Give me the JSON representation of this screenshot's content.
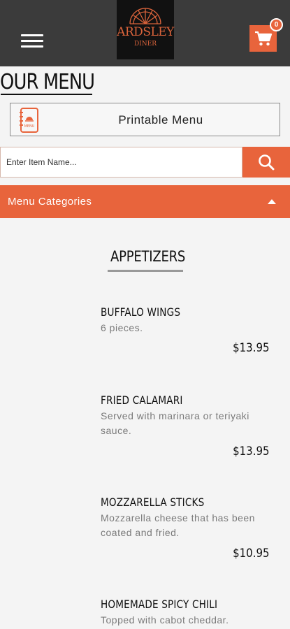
{
  "header": {
    "logo": {
      "name": "ARDSLEY",
      "sub": "DINER"
    },
    "cart_count": "0",
    "accent_color": "#e8643c",
    "bar_color": "#3b3b3b"
  },
  "page_title": "OUR MENU",
  "printable_menu": {
    "label": "Printable Menu",
    "icon_text": "MENU"
  },
  "search": {
    "placeholder": "Enter Item Name..."
  },
  "categories": {
    "label": "Menu Categories"
  },
  "section": {
    "title": "APPETIZERS"
  },
  "items": [
    {
      "name": "BUFFALO WINGS",
      "desc": "6 pieces.",
      "price": "$13.95"
    },
    {
      "name": "FRIED CALAMARI",
      "desc": "Served with marinara or teriyaki sauce.",
      "price": "$13.95"
    },
    {
      "name": "MOZZARELLA STICKS",
      "desc": "Mozzarella cheese that has been coated and fried.",
      "price": "$10.95"
    },
    {
      "name": "HOMEMADE SPICY CHILI",
      "desc": "Topped with cabot cheddar.",
      "price": ""
    }
  ],
  "icons": [
    "hamburger-menu-icon",
    "cart-icon",
    "menu-book-icon",
    "search-icon",
    "caret-up-icon"
  ]
}
